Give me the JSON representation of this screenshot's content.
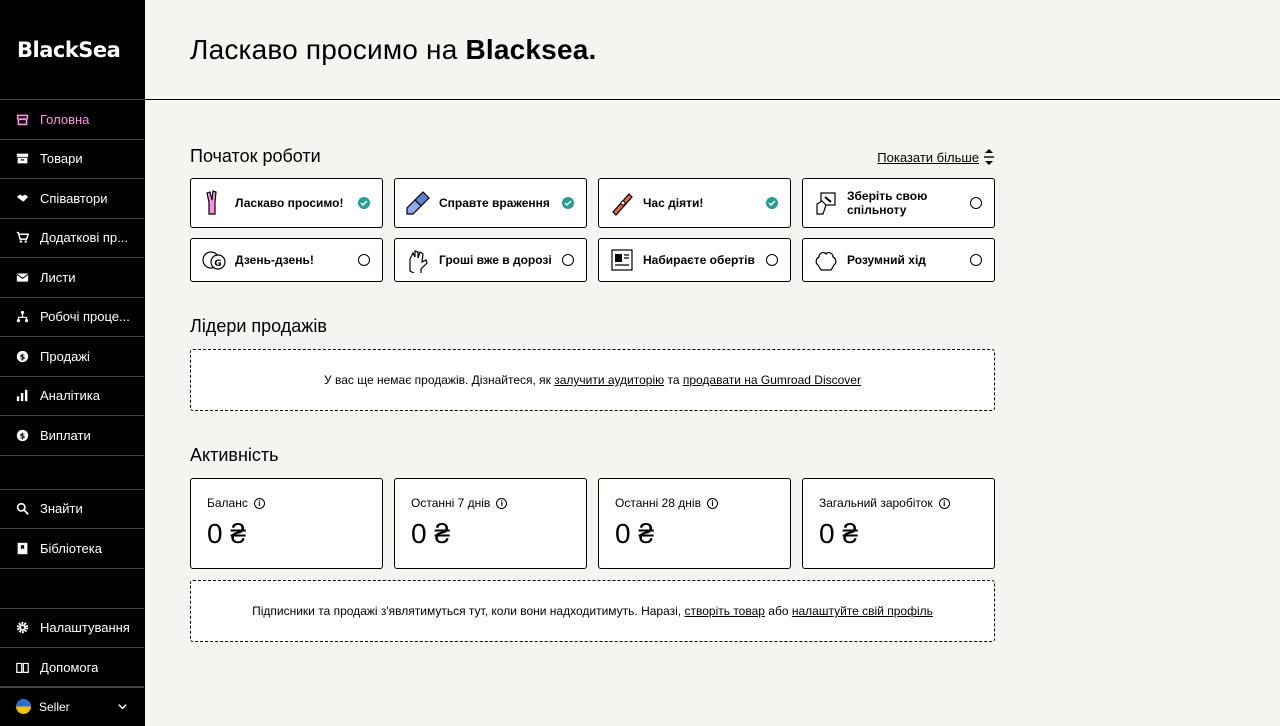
{
  "brand": "BlackSea",
  "nav": [
    {
      "label": "Головна",
      "icon": "shop-icon",
      "active": true
    },
    {
      "label": "Товари",
      "icon": "archive-icon"
    },
    {
      "label": "Співавтори",
      "icon": "handshake-icon"
    },
    {
      "label": "Додаткові пр...",
      "icon": "cart-icon"
    },
    {
      "label": "Листи",
      "icon": "envelope-icon"
    },
    {
      "label": "Робочі проце...",
      "icon": "diagram-icon"
    },
    {
      "label": "Продажі",
      "icon": "currency-icon"
    },
    {
      "label": "Аналітика",
      "icon": "bar-chart-icon"
    },
    {
      "label": "Виплати",
      "icon": "payout-icon"
    }
  ],
  "nav_secondary": [
    {
      "label": "Знайти",
      "icon": "search-icon"
    },
    {
      "label": "Бібліотека",
      "icon": "bookmark-icon"
    }
  ],
  "nav_bottom": [
    {
      "label": "Налаштування",
      "icon": "gear-icon"
    },
    {
      "label": "Допомога",
      "icon": "book-icon"
    }
  ],
  "user": {
    "name": "Seller"
  },
  "header": {
    "title_prefix": "Ласкаво просимо на ",
    "title_brand": "Blacksea."
  },
  "getting_started": {
    "title": "Початок роботи",
    "show_more": "Показати більше",
    "cards": [
      {
        "label": "Ласкаво просимо!",
        "done": true
      },
      {
        "label": "Справте враження",
        "done": true
      },
      {
        "label": "Час діяти!",
        "done": true
      },
      {
        "label": "Зберіть свою спільноту",
        "done": false
      },
      {
        "label": "Дзень-дзень!",
        "done": false
      },
      {
        "label": "Гроші вже в дорозі",
        "done": false
      },
      {
        "label": "Набираєте обертів",
        "done": false
      },
      {
        "label": "Розумний хід",
        "done": false
      }
    ]
  },
  "sales": {
    "title": "Лідери продажів",
    "empty_text": "У вас ще немає продажів. Дізнайтеся, як ",
    "link1": "залучити аудиторію",
    "mid": " та ",
    "link2": "продавати на Gumroad Discover"
  },
  "activity": {
    "title": "Активність",
    "stats": [
      {
        "label": "Баланс",
        "value": "0 ₴"
      },
      {
        "label": "Останні 7 днів",
        "value": "0 ₴"
      },
      {
        "label": "Останні 28 днів",
        "value": "0 ₴"
      },
      {
        "label": "Загальний заробіток",
        "value": "0 ₴"
      }
    ],
    "empty_text": "Підписники та продажі з'являтимуться тут, коли вони надходитимуть. Наразі, ",
    "link1": "створіть товар",
    "mid": " або ",
    "link2": "налаштуйте свій профіль"
  },
  "colors": {
    "accent": "#ff90e8",
    "done": "#23a094",
    "sidebar": "#000000",
    "background": "#f4f4f0"
  }
}
